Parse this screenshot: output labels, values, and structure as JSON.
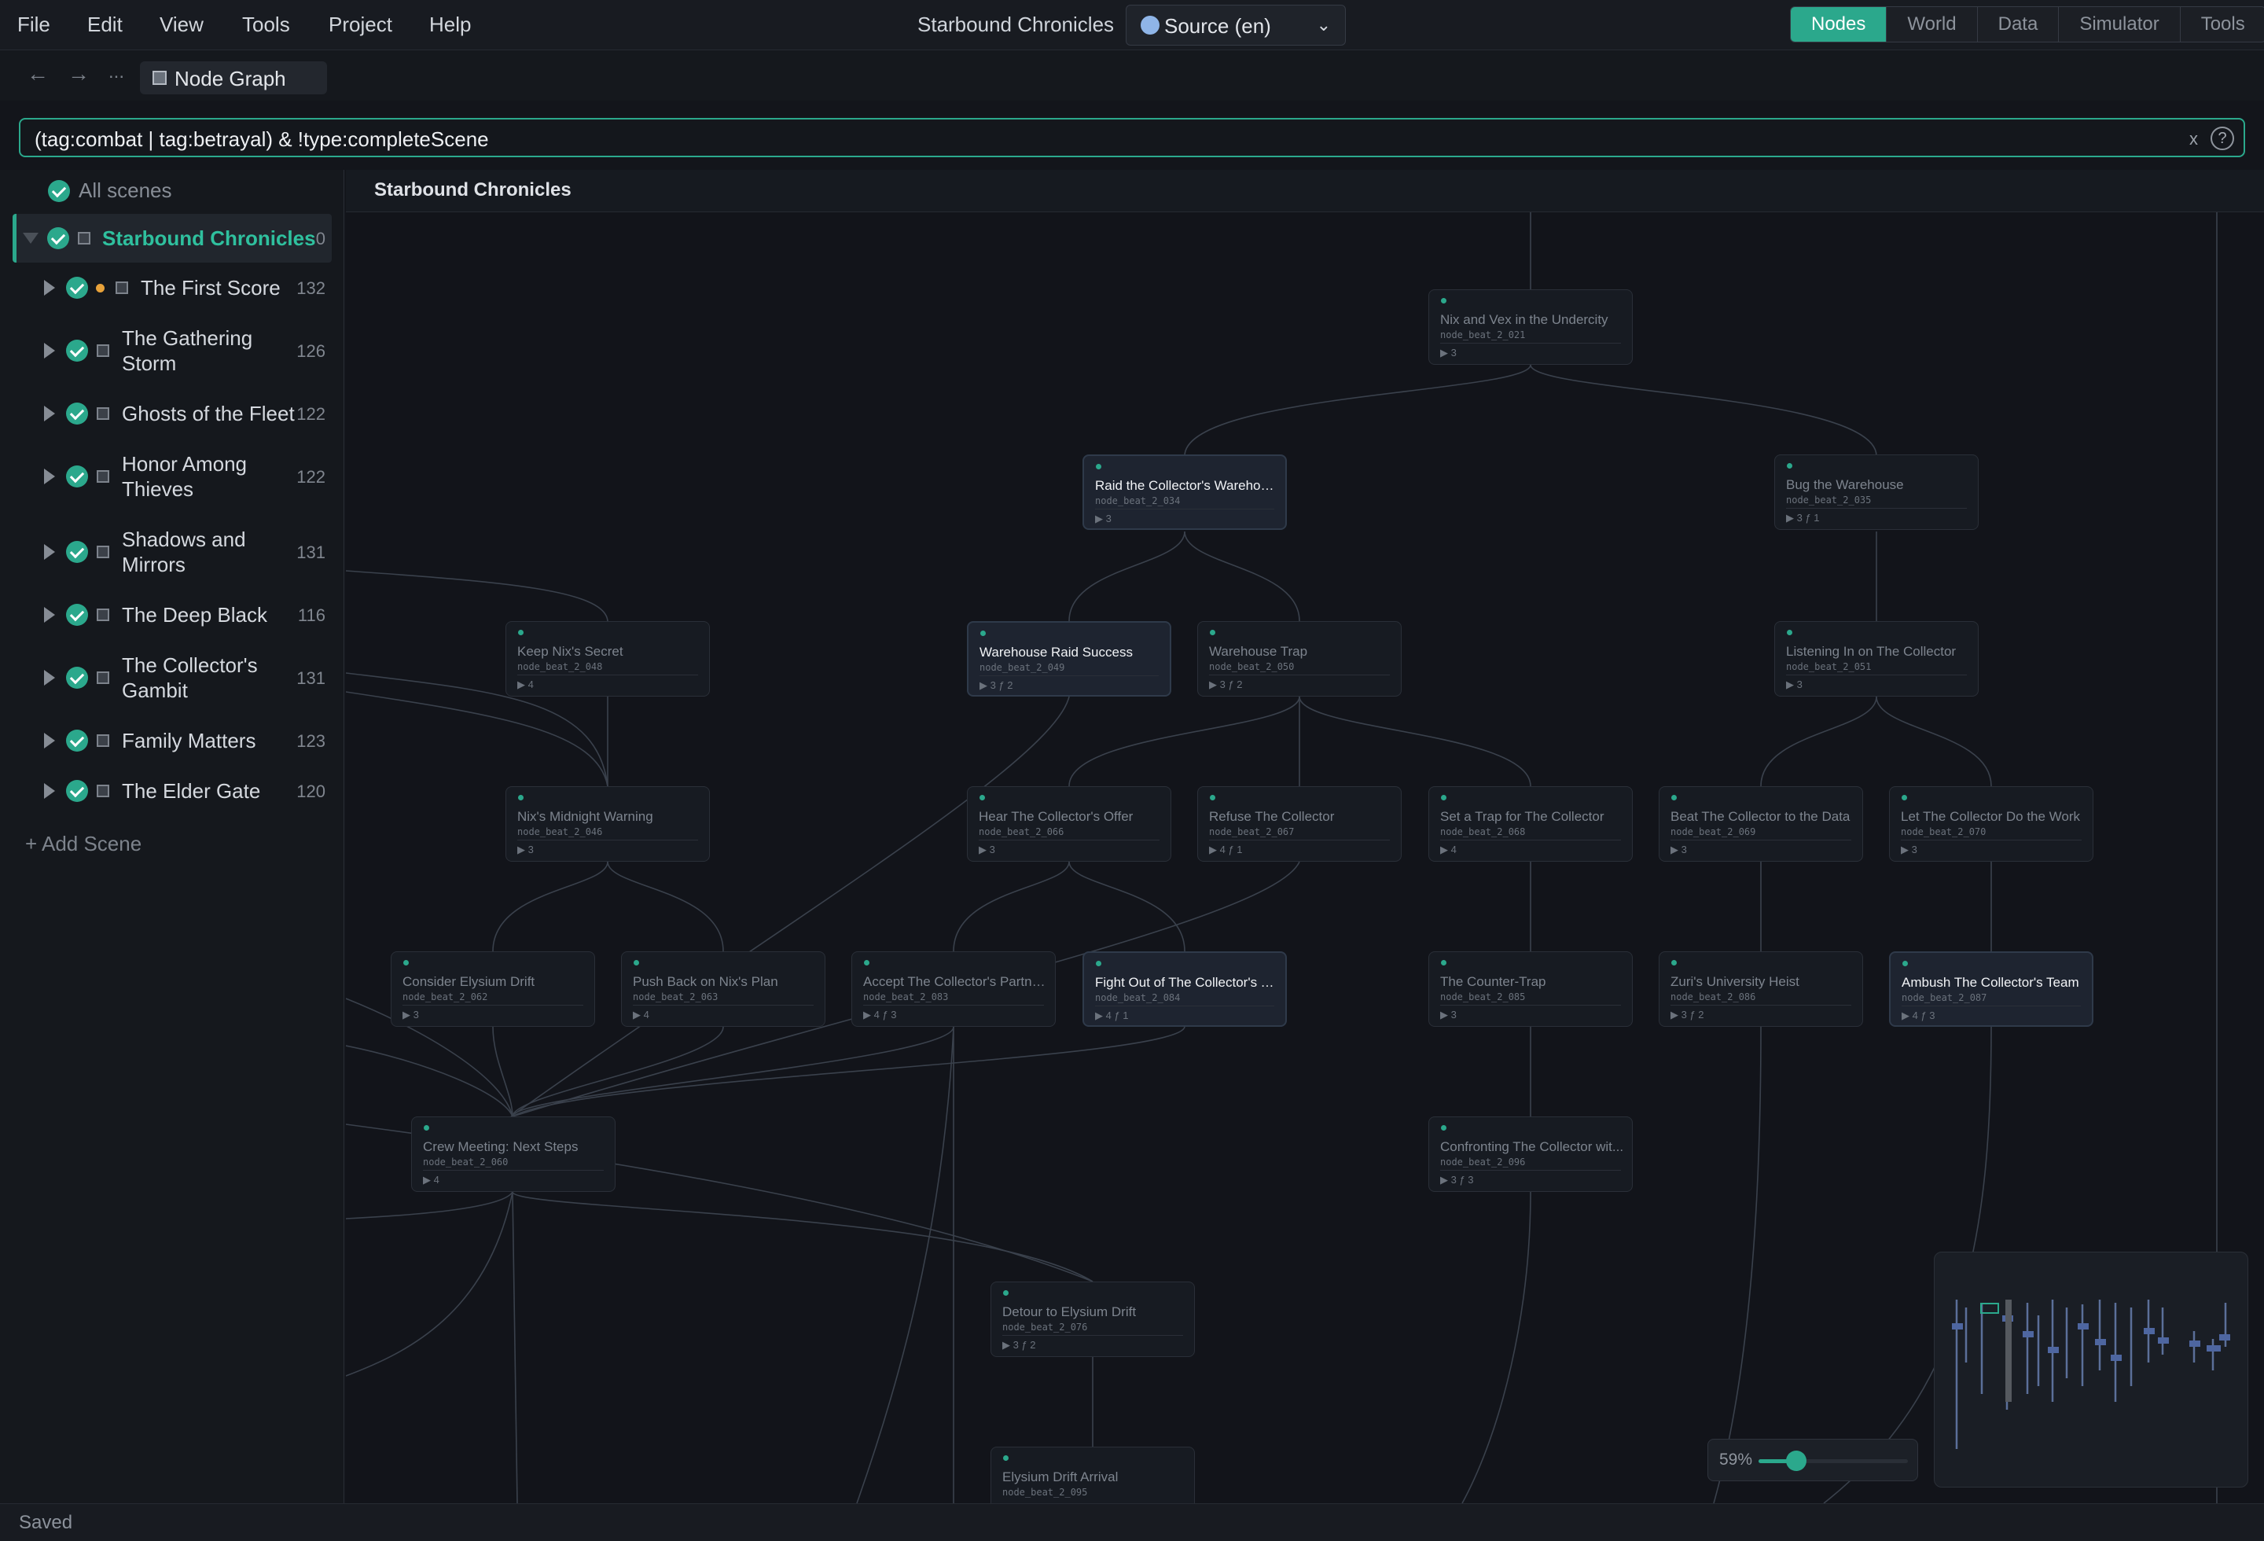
{
  "menu": [
    "File",
    "Edit",
    "View",
    "Tools",
    "Project",
    "Help"
  ],
  "app_title": "Starbound Chronicles",
  "language": {
    "label": "Source (en)",
    "icon": "globe-icon"
  },
  "modes": [
    {
      "label": "Nodes",
      "active": true
    },
    {
      "label": "World",
      "active": false
    },
    {
      "label": "Data",
      "active": false
    },
    {
      "label": "Simulator",
      "active": false
    },
    {
      "label": "Tools",
      "active": false
    }
  ],
  "nav": {
    "back": "←",
    "forward": "→",
    "more": "...",
    "crumb": "Node Graph"
  },
  "filter": {
    "value": "(tag:combat | tag:betrayal) & !type:completeScene",
    "clear": "x",
    "help": "?"
  },
  "sidebar": {
    "all_label": "All scenes",
    "root": {
      "label": "Starbound Chronicles",
      "count": "0"
    },
    "scenes": [
      {
        "label": "The First Score",
        "count": "132",
        "modified": true
      },
      {
        "label": "The Gathering Storm",
        "count": "126"
      },
      {
        "label": "Ghosts of the Fleet",
        "count": "122"
      },
      {
        "label": "Honor Among Thieves",
        "count": "122"
      },
      {
        "label": "Shadows and Mirrors",
        "count": "131"
      },
      {
        "label": "The Deep Black",
        "count": "116"
      },
      {
        "label": "The Collector's Gambit",
        "count": "131"
      },
      {
        "label": "Family Matters",
        "count": "123"
      },
      {
        "label": "The Elder Gate",
        "count": "120"
      }
    ],
    "add_label": "+ Add Scene"
  },
  "canvas": {
    "title": "Starbound Chronicles"
  },
  "nodes": [
    {
      "id": "n021",
      "title": "Nix and Vex in the Undercity",
      "node_id": "node_beat_2_021",
      "meta": "▶ 3",
      "highlight": false
    },
    {
      "id": "n034",
      "title": "Raid the Collector's Warehouse",
      "node_id": "node_beat_2_034",
      "meta": "▶ 3",
      "highlight": true
    },
    {
      "id": "n035",
      "title": "Bug the Warehouse",
      "node_id": "node_beat_2_035",
      "meta": "▶ 3   ƒ 1",
      "highlight": false
    },
    {
      "id": "n048",
      "title": "Keep Nix's Secret",
      "node_id": "node_beat_2_048",
      "meta": "▶ 4",
      "highlight": false
    },
    {
      "id": "n049",
      "title": "Warehouse Raid Success",
      "node_id": "node_beat_2_049",
      "meta": "▶ 3   ƒ 2",
      "highlight": true
    },
    {
      "id": "n050",
      "title": "Warehouse Trap",
      "node_id": "node_beat_2_050",
      "meta": "▶ 3   ƒ 2",
      "highlight": false
    },
    {
      "id": "n051",
      "title": "Listening In on The Collector",
      "node_id": "node_beat_2_051",
      "meta": "▶ 3",
      "highlight": false
    },
    {
      "id": "n046",
      "title": "Nix's Midnight Warning",
      "node_id": "node_beat_2_046",
      "meta": "▶ 3",
      "highlight": false
    },
    {
      "id": "n066",
      "title": "Hear The Collector's Offer",
      "node_id": "node_beat_2_066",
      "meta": "▶ 3",
      "highlight": false
    },
    {
      "id": "n067",
      "title": "Refuse The Collector",
      "node_id": "node_beat_2_067",
      "meta": "▶ 4   ƒ 1",
      "highlight": false
    },
    {
      "id": "n068",
      "title": "Set a Trap for The Collector",
      "node_id": "node_beat_2_068",
      "meta": "▶ 4",
      "highlight": false
    },
    {
      "id": "n069",
      "title": "Beat The Collector to the Data",
      "node_id": "node_beat_2_069",
      "meta": "▶ 3",
      "highlight": false
    },
    {
      "id": "n070",
      "title": "Let The Collector Do the Work",
      "node_id": "node_beat_2_070",
      "meta": "▶ 3",
      "highlight": false
    },
    {
      "id": "n062",
      "title": "Consider Elysium Drift",
      "node_id": "node_beat_2_062",
      "meta": "▶ 3",
      "highlight": false
    },
    {
      "id": "n063",
      "title": "Push Back on Nix's Plan",
      "node_id": "node_beat_2_063",
      "meta": "▶ 4",
      "highlight": false
    },
    {
      "id": "n083",
      "title": "Accept The Collector's Partne...",
      "node_id": "node_beat_2_083",
      "meta": "▶ 4   ƒ 3",
      "highlight": false
    },
    {
      "id": "n084",
      "title": "Fight Out of The Collector's Tr...",
      "node_id": "node_beat_2_084",
      "meta": "▶ 4   ƒ 1",
      "highlight": true
    },
    {
      "id": "n085",
      "title": "The Counter-Trap",
      "node_id": "node_beat_2_085",
      "meta": "▶ 3",
      "highlight": false
    },
    {
      "id": "n086",
      "title": "Zuri's University Heist",
      "node_id": "node_beat_2_086",
      "meta": "▶ 3   ƒ 2",
      "highlight": false
    },
    {
      "id": "n087",
      "title": "Ambush The Collector's Team",
      "node_id": "node_beat_2_087",
      "meta": "▶ 4   ƒ 3",
      "highlight": true
    },
    {
      "id": "n060",
      "title": "Crew Meeting: Next Steps",
      "node_id": "node_beat_2_060",
      "meta": "▶ 4",
      "highlight": false
    },
    {
      "id": "n096",
      "title": "Confronting The Collector wit...",
      "node_id": "node_beat_2_096",
      "meta": "▶ 3   ƒ 3",
      "highlight": false
    },
    {
      "id": "n076",
      "title": "Detour to Elysium Drift",
      "node_id": "node_beat_2_076",
      "meta": "▶ 3   ƒ 2",
      "highlight": false
    },
    {
      "id": "n095",
      "title": "Elysium Drift Arrival",
      "node_id": "node_beat_2_095",
      "meta": "",
      "highlight": false
    }
  ],
  "zoom": {
    "label": "59%",
    "value": 0.59
  },
  "status": "Saved",
  "colors": {
    "accent": "#2ba88c",
    "background": "#12141a",
    "panel": "#15181d"
  }
}
